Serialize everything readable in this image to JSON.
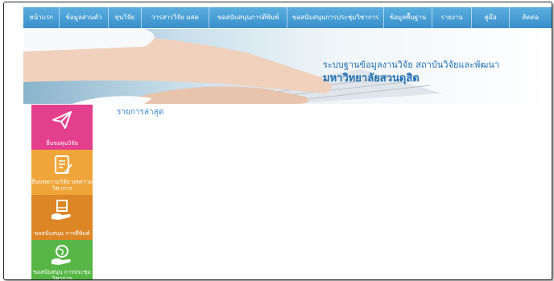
{
  "nav": {
    "items": [
      {
        "label": "หน้าแรก"
      },
      {
        "label": "ข้อมูลส่วนตัว"
      },
      {
        "label": "ทุนวิจัย"
      },
      {
        "label": "วารสารวิจัย มสด"
      },
      {
        "label": "ขอสนับสนุนการตีพิมพ์"
      },
      {
        "label": "ขอสนับสนุนการประชุมวิชาการ"
      },
      {
        "label": "ข้อมูลพื้นฐาน"
      },
      {
        "label": "รายงาน"
      },
      {
        "label": "คู่มือ"
      },
      {
        "label": "ติดต่อ"
      }
    ]
  },
  "banner": {
    "title": "ระบบฐานข้อมูลงานวิจัย สถาบันวิจัยและพัฒนา",
    "subtitle": "มหาวิทยาลัยสวนดุสิต"
  },
  "main": {
    "latest_heading": "รายการล่าสุด"
  },
  "sidebar": {
    "tiles": [
      {
        "label": "ยื่นขอทุนวิจัย",
        "icon": "paper-plane-icon",
        "color": "#e43f8c"
      },
      {
        "label": "ยื่นบทความวิจัย บทความวิชาการ",
        "icon": "document-edit-icon",
        "color": "#f0a53a"
      },
      {
        "label": "ขอสนับสนุน การตีพิมพ์",
        "icon": "book-hand-icon",
        "color": "#dd8626"
      },
      {
        "label": "ขอสนับสนุน การประชุมวิชาการ",
        "icon": "globe-hand-icon",
        "color": "#58b647"
      }
    ]
  },
  "colors": {
    "nav_bg": "#3a8fcb",
    "banner_text": "#1f6fb0",
    "heading_text": "#3b8ad0"
  }
}
